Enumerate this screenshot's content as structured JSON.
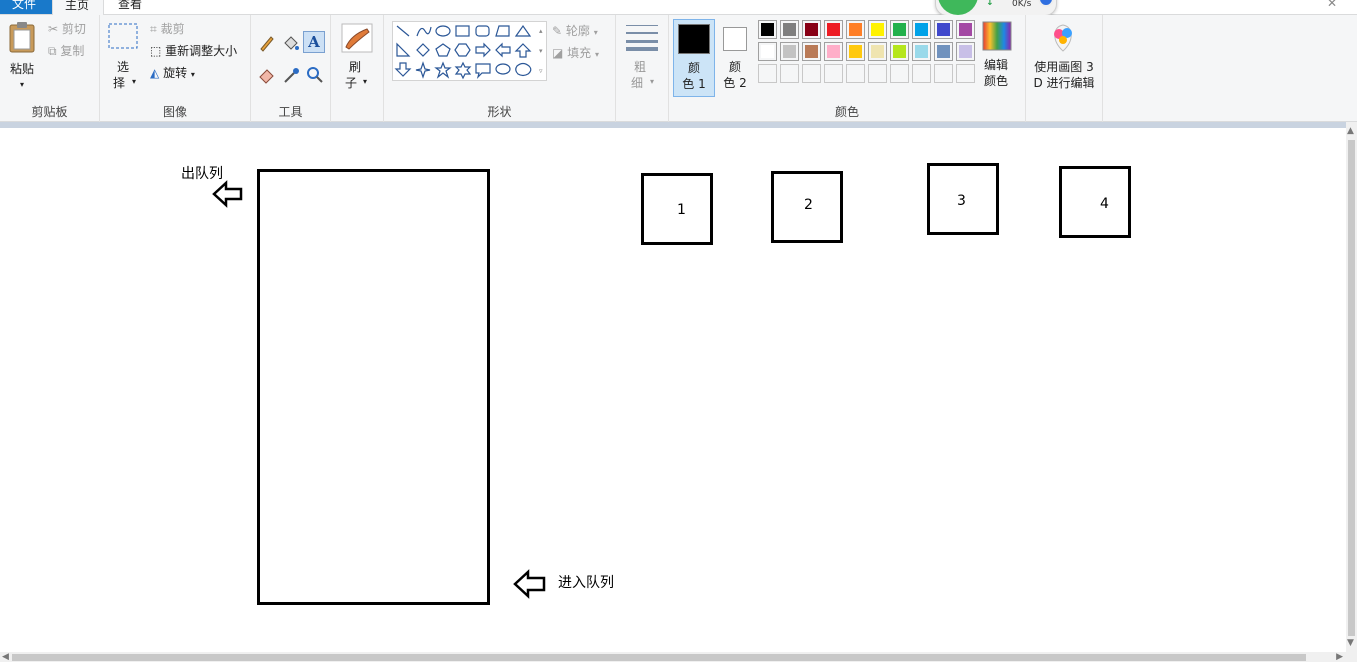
{
  "tabs": {
    "file": "文件",
    "home": "主页",
    "view": "查看"
  },
  "speed": {
    "value": "0K/s"
  },
  "clipboard": {
    "paste": "粘贴",
    "cut": "剪切",
    "copy": "复制",
    "label": "剪贴板"
  },
  "image": {
    "select_a": "选",
    "select_b": "择",
    "crop": "裁剪",
    "resize": "重新调整大小",
    "rotate": "旋转",
    "label": "图像"
  },
  "tools": {
    "label": "工具"
  },
  "brush": {
    "label_a": "刷",
    "label_b": "子"
  },
  "shapes": {
    "outline": "轮廓",
    "fill": "填充",
    "label": "形状"
  },
  "size": {
    "label_a": "粗",
    "label_b": "细"
  },
  "colors": {
    "color1_a": "颜",
    "color1_b": "色 1",
    "color2_a": "颜",
    "color2_b": "色 2",
    "edit_a": "编辑",
    "edit_b": "颜色",
    "label": "颜色",
    "row1": [
      "#000000",
      "#7f7f7f",
      "#880015",
      "#ed1c24",
      "#ff7f27",
      "#fff200",
      "#22b14c",
      "#00a2e8",
      "#3f48cc",
      "#a349a4"
    ],
    "row2": [
      "#ffffff",
      "#c3c3c3",
      "#b97a57",
      "#ffaec9",
      "#ffc90e",
      "#efe4b0",
      "#b5e61d",
      "#99d9ea",
      "#7092be",
      "#c8bfe7"
    ],
    "color1_value": "#000000",
    "color2_value": "#ffffff"
  },
  "paint3d": {
    "line1": "使用画图 3",
    "line2": "D 进行编辑"
  },
  "canvas": {
    "dequeue_label": "出队列",
    "enqueue_label": "进入队列",
    "boxes": [
      "1",
      "2",
      "3",
      "4"
    ]
  }
}
